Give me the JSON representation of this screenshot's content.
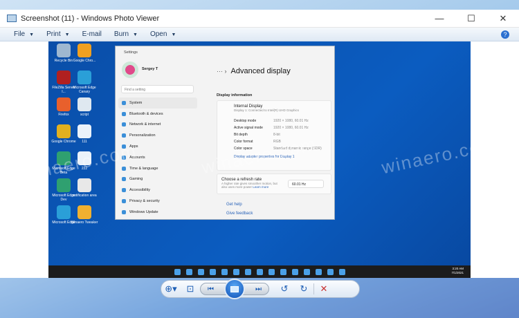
{
  "window": {
    "title": "Screenshot (11) - Windows Photo Viewer",
    "minimize": "—",
    "maximize": "☐",
    "close": "✕"
  },
  "menu": [
    {
      "label": "File"
    },
    {
      "label": "Print"
    },
    {
      "label": "E-mail"
    },
    {
      "label": "Burn"
    },
    {
      "label": "Open"
    }
  ],
  "help": "?",
  "desktop_icons": [
    {
      "label": "Recycle Bin",
      "color": "#9fb8d0"
    },
    {
      "label": "Google Chro...",
      "color": "#f0a020"
    },
    {
      "label": "FileZilla Server I...",
      "color": "#b02020"
    },
    {
      "label": "Microsoft Edge Canary",
      "color": "#2a9fd8"
    },
    {
      "label": "Firefox",
      "color": "#e8602c"
    },
    {
      "label": "script",
      "color": "#dfe8f0"
    },
    {
      "label": "Google Chrome",
      "color": "#e0b020"
    },
    {
      "label": "111",
      "color": "#eaf2fa"
    },
    {
      "label": "Microsoft Edge Beta",
      "color": "#2fa070"
    },
    {
      "label": "222",
      "color": "#eaf2fa"
    },
    {
      "label": "Microsoft Edge Dev",
      "color": "#2fa070"
    },
    {
      "label": "notification area",
      "color": "#e8e8e8"
    },
    {
      "label": "Microsoft Edge",
      "color": "#2a9fd8"
    },
    {
      "label": "Winaero Tweaker",
      "color": "#f0b030"
    }
  ],
  "settings": {
    "app_title": "Settings",
    "user": "Sergey T",
    "search_placeholder": "Find a setting",
    "nav": [
      "System",
      "Bluetooth & devices",
      "Network & internet",
      "Personalization",
      "Apps",
      "Accounts",
      "Time & language",
      "Gaming",
      "Accessibility",
      "Privacy & security",
      "Windows Update"
    ],
    "breadcrumb_more": "··· ›",
    "page_title": "Advanced display",
    "section": "Display information",
    "display_name": "Internal Display",
    "display_sub": "Display 1: Connected to Intel(R) UHD Graphics",
    "info": [
      {
        "k": "Desktop mode",
        "v": "1920 × 1080, 60.01 Hz"
      },
      {
        "k": "Active signal mode",
        "v": "1920 × 1080, 60.01 Hz"
      },
      {
        "k": "Bit depth",
        "v": "8-bit"
      },
      {
        "k": "Color format",
        "v": "RGB"
      },
      {
        "k": "Color space",
        "v": "Standard dynamic range (SDR)"
      }
    ],
    "adapter_link": "Display adapter properties for Display 1",
    "refresh_title": "Choose a refresh rate",
    "refresh_desc": "A higher rate gives smoother motion, but also uses more power",
    "learn_more": "Learn more",
    "refresh_value": "60.01 Hz",
    "get_help": "Get help",
    "feedback": "Give feedback"
  },
  "taskbar": {
    "time": "3:20 AM",
    "date": "7/1/2021"
  },
  "watermark": "winaero.com"
}
